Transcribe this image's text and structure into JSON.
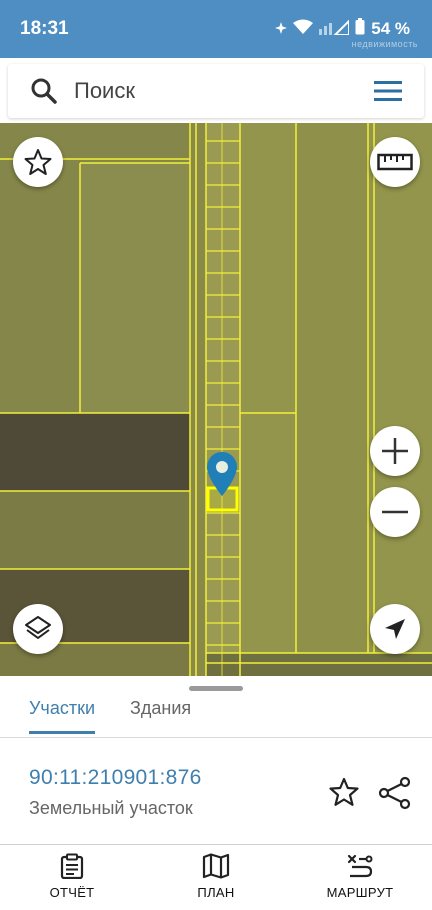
{
  "status_bar": {
    "time": "18:31",
    "battery": "54 %",
    "watermark": "недвижимость"
  },
  "search": {
    "placeholder": "Поиск"
  },
  "colors": {
    "status_bar": "#4f8ec2",
    "accent": "#3f7fae",
    "parcel_outline": "#f2f03a",
    "selected_parcel": "#ffff00",
    "pin": "#1f7fb6"
  },
  "map": {
    "icons": [
      "star-icon",
      "ruler-icon",
      "zoom-in-icon",
      "zoom-out-icon",
      "layers-icon",
      "my-location-icon",
      "location-pin-icon"
    ]
  },
  "sheet": {
    "tabs": [
      {
        "label": "Участки",
        "active": true
      },
      {
        "label": "Здания",
        "active": false
      }
    ],
    "parcel": {
      "cadastral_number": "90:11:210901:876",
      "type": "Земельный участок"
    }
  },
  "bottom_nav": [
    {
      "label": "ОТЧЁТ",
      "icon": "report-icon"
    },
    {
      "label": "ПЛАН",
      "icon": "map-plan-icon"
    },
    {
      "label": "МАРШРУТ",
      "icon": "route-icon"
    }
  ]
}
